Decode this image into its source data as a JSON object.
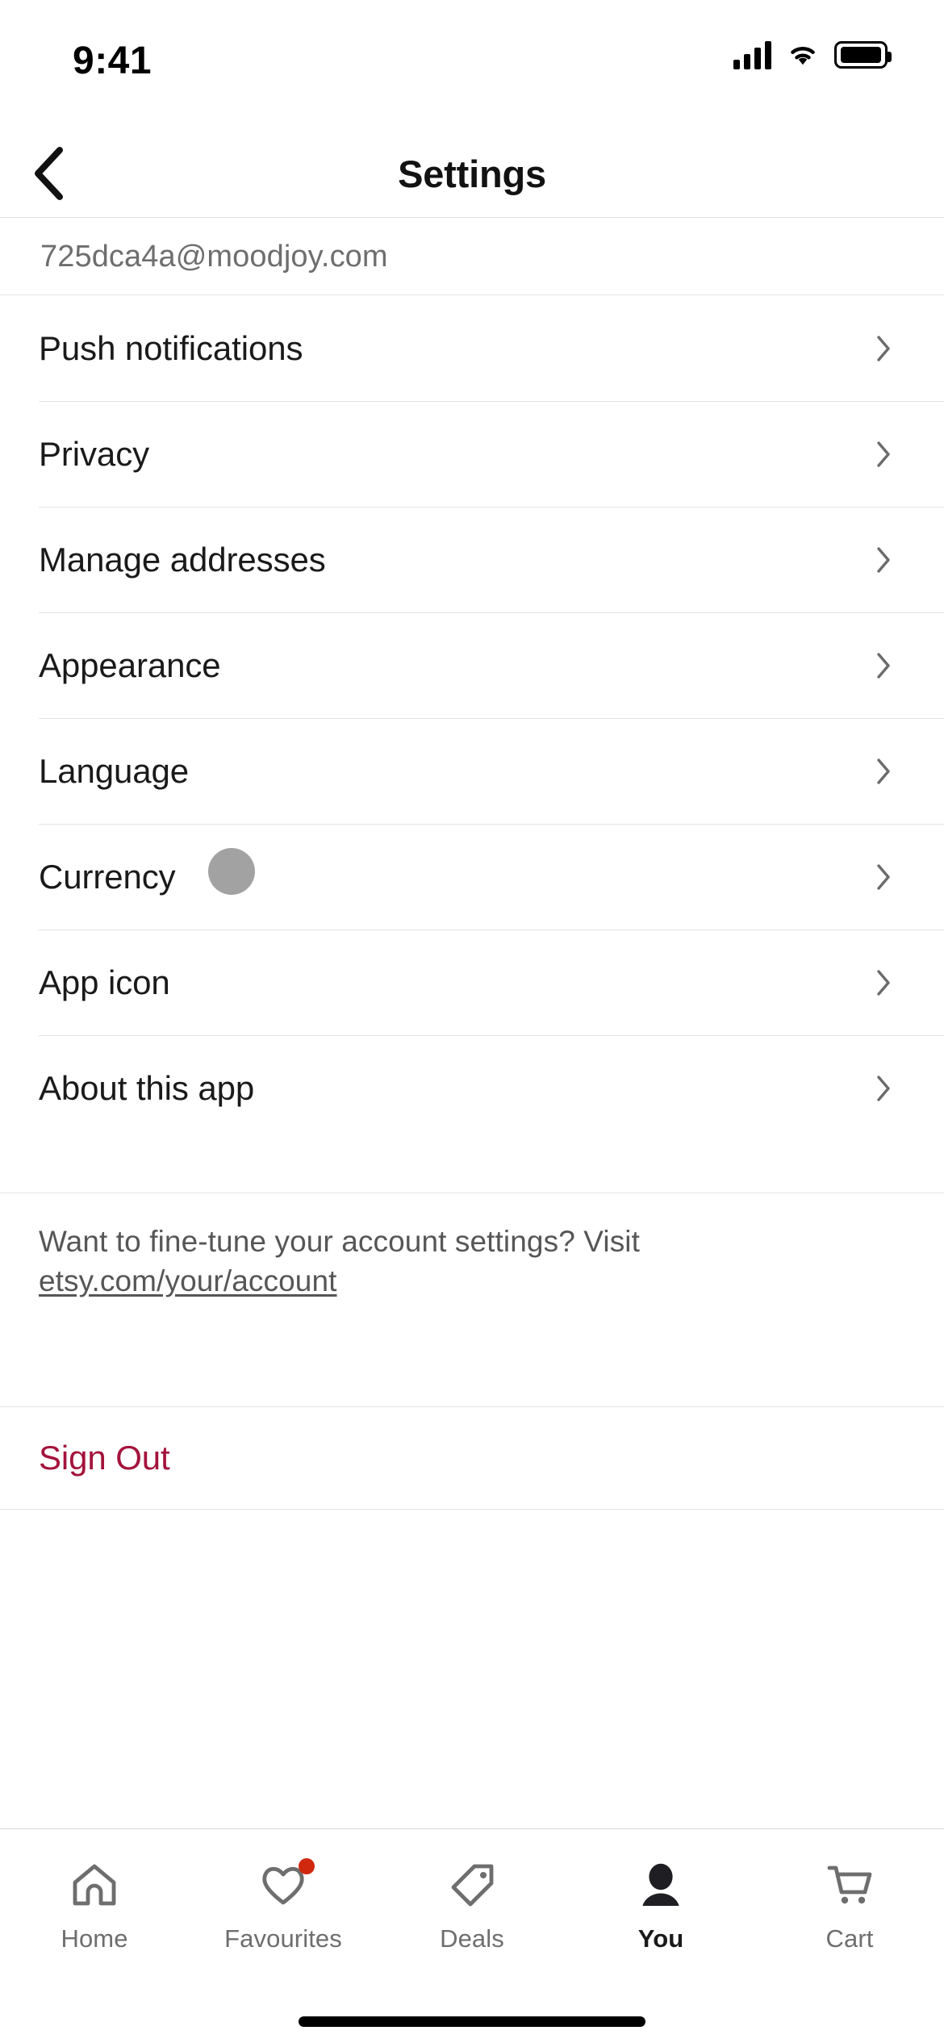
{
  "status_bar": {
    "time": "9:41",
    "cellular_icon": "cellular-signal-icon",
    "wifi_icon": "wifi-icon",
    "battery_icon": "battery-full-icon"
  },
  "nav": {
    "back_icon": "chevron-left-icon",
    "title": "Settings"
  },
  "account": {
    "email": "725dca4a@moodjoy.com"
  },
  "settings": {
    "rows": [
      {
        "label": "Push notifications",
        "chevron": "chevron-right-icon"
      },
      {
        "label": "Privacy",
        "chevron": "chevron-right-icon"
      },
      {
        "label": "Manage addresses",
        "chevron": "chevron-right-icon"
      },
      {
        "label": "Appearance",
        "chevron": "chevron-right-icon"
      },
      {
        "label": "Language",
        "chevron": "chevron-right-icon"
      },
      {
        "label": "Currency",
        "chevron": "chevron-right-icon"
      },
      {
        "label": "App icon",
        "chevron": "chevron-right-icon"
      },
      {
        "label": "About this app",
        "chevron": "chevron-right-icon"
      }
    ]
  },
  "note": {
    "text": "Want to fine-tune your account settings? Visit ",
    "link_text": "etsy.com/your/account"
  },
  "sign_out": {
    "label": "Sign Out",
    "color": "#a4133c"
  },
  "tab_bar": {
    "tabs": [
      {
        "label": "Home",
        "icon": "home-icon",
        "active": false,
        "badge": false
      },
      {
        "label": "Favourites",
        "icon": "heart-icon",
        "active": false,
        "badge": true
      },
      {
        "label": "Deals",
        "icon": "tag-icon",
        "active": false,
        "badge": false
      },
      {
        "label": "You",
        "icon": "person-icon",
        "active": true,
        "badge": false
      },
      {
        "label": "Cart",
        "icon": "cart-icon",
        "active": false,
        "badge": false
      }
    ],
    "badge_color": "#d0280f"
  },
  "colors": {
    "accent": "#a4133c",
    "divider": "#e3e3e3",
    "muted_text": "#6e6e6e"
  }
}
